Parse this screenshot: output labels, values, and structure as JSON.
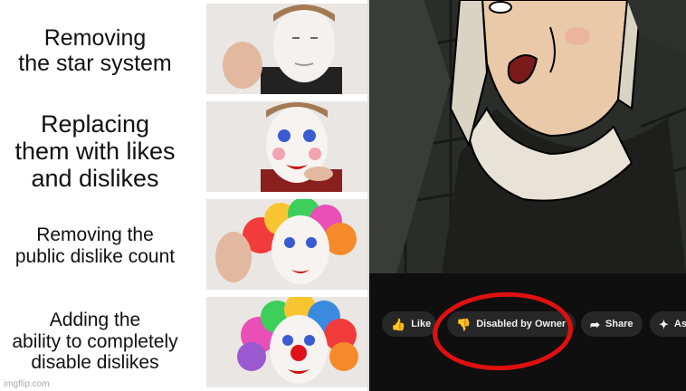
{
  "meme": {
    "panels": [
      {
        "caption": "Removing\nthe star system"
      },
      {
        "caption": "Replacing\nthem with likes\nand dislikes"
      },
      {
        "caption": "Removing the\npublic dislike count"
      },
      {
        "caption": "Adding the\nability to completely\ndisable dislikes"
      }
    ],
    "watermark": "imgflip.com"
  },
  "video_actions": {
    "like_label": "Like",
    "dislike_label": "Disabled by Owner",
    "share_label": "Share",
    "ask_label": "As",
    "like_icon": "thumbs-up-icon",
    "dislike_icon": "thumbs-down-icon",
    "share_icon": "share-arrow-icon",
    "ask_icon": "sparkle-icon"
  },
  "colors": {
    "highlight_circle": "#e01010",
    "button_bg": "#272727",
    "bar_bg": "#0f0f0f"
  }
}
